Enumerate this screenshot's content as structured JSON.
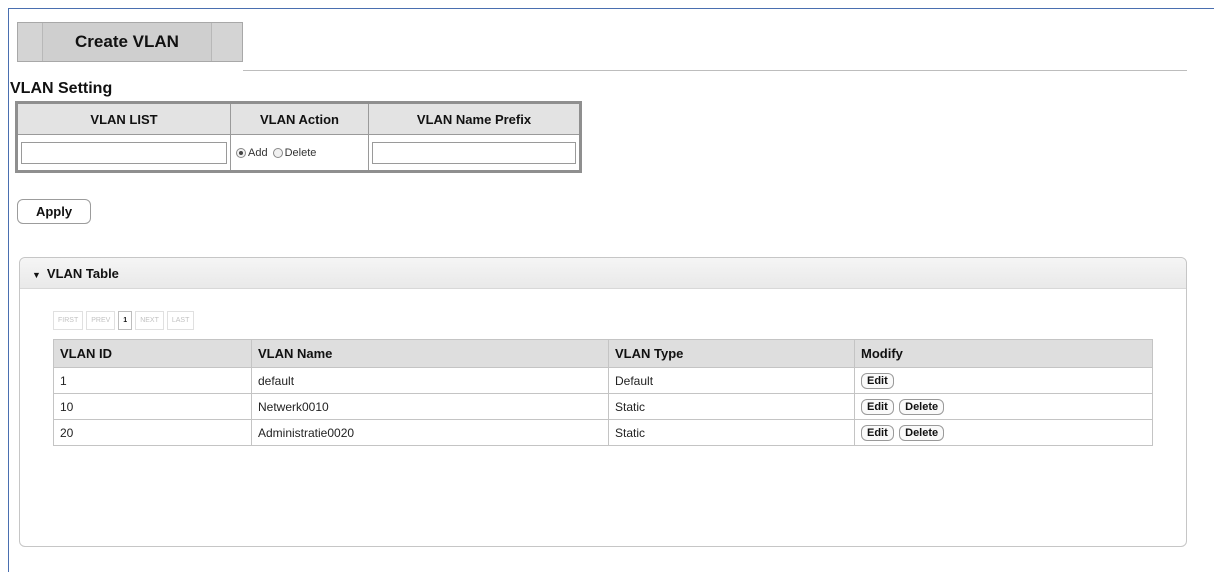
{
  "header": {
    "tab_label": "Create VLAN"
  },
  "vlan_setting": {
    "title": "VLAN Setting",
    "columns": [
      "VLAN LIST",
      "VLAN Action",
      "VLAN Name Prefix"
    ],
    "vlan_list_value": "",
    "action_options": [
      "Add",
      "Delete"
    ],
    "action_selected": "Add",
    "name_prefix_value": "",
    "apply_label": "Apply"
  },
  "vlan_table": {
    "title": "VLAN Table",
    "pager": [
      "FIRST",
      "PREV",
      "1",
      "NEXT",
      "LAST"
    ],
    "current_page": "1",
    "columns": [
      "VLAN ID",
      "VLAN Name",
      "VLAN Type",
      "Modify"
    ],
    "rows": [
      {
        "id": "1",
        "name": "default",
        "type": "Default",
        "actions": [
          "Edit"
        ]
      },
      {
        "id": "10",
        "name": "Netwerk0010",
        "type": "Static",
        "actions": [
          "Edit",
          "Delete"
        ]
      },
      {
        "id": "20",
        "name": "Administratie0020",
        "type": "Static",
        "actions": [
          "Edit",
          "Delete"
        ]
      }
    ]
  },
  "colors": {
    "frame_border": "#4a6fb0",
    "header_bg": "#dedede"
  }
}
